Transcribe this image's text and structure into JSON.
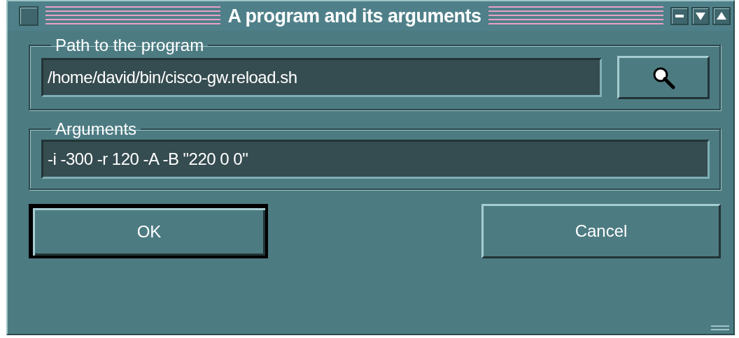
{
  "window": {
    "title": "A program and its arguments"
  },
  "groups": [
    {
      "kind": "path",
      "label": "Path to the program",
      "value": "/home/david/bin/cisco-gw.reload.sh"
    },
    {
      "kind": "text",
      "label": "Arguments",
      "value": "-i -300 -r 120 -A -B \"220 0 0\""
    }
  ],
  "buttons": [
    {
      "label": "OK",
      "default": true
    },
    {
      "label": "Cancel",
      "default": false
    }
  ]
}
